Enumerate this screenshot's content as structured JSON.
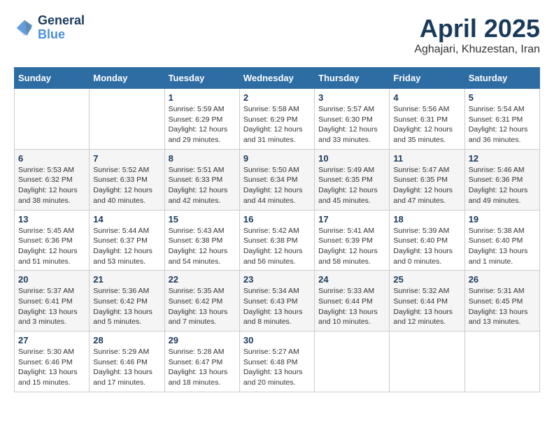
{
  "header": {
    "logo_general": "General",
    "logo_blue": "Blue",
    "month_title": "April 2025",
    "location": "Aghajari, Khuzestan, Iran"
  },
  "weekdays": [
    "Sunday",
    "Monday",
    "Tuesday",
    "Wednesday",
    "Thursday",
    "Friday",
    "Saturday"
  ],
  "weeks": [
    [
      {
        "day": "",
        "info": ""
      },
      {
        "day": "",
        "info": ""
      },
      {
        "day": "1",
        "info": "Sunrise: 5:59 AM\nSunset: 6:29 PM\nDaylight: 12 hours and 29 minutes."
      },
      {
        "day": "2",
        "info": "Sunrise: 5:58 AM\nSunset: 6:29 PM\nDaylight: 12 hours and 31 minutes."
      },
      {
        "day": "3",
        "info": "Sunrise: 5:57 AM\nSunset: 6:30 PM\nDaylight: 12 hours and 33 minutes."
      },
      {
        "day": "4",
        "info": "Sunrise: 5:56 AM\nSunset: 6:31 PM\nDaylight: 12 hours and 35 minutes."
      },
      {
        "day": "5",
        "info": "Sunrise: 5:54 AM\nSunset: 6:31 PM\nDaylight: 12 hours and 36 minutes."
      }
    ],
    [
      {
        "day": "6",
        "info": "Sunrise: 5:53 AM\nSunset: 6:32 PM\nDaylight: 12 hours and 38 minutes."
      },
      {
        "day": "7",
        "info": "Sunrise: 5:52 AM\nSunset: 6:33 PM\nDaylight: 12 hours and 40 minutes."
      },
      {
        "day": "8",
        "info": "Sunrise: 5:51 AM\nSunset: 6:33 PM\nDaylight: 12 hours and 42 minutes."
      },
      {
        "day": "9",
        "info": "Sunrise: 5:50 AM\nSunset: 6:34 PM\nDaylight: 12 hours and 44 minutes."
      },
      {
        "day": "10",
        "info": "Sunrise: 5:49 AM\nSunset: 6:35 PM\nDaylight: 12 hours and 45 minutes."
      },
      {
        "day": "11",
        "info": "Sunrise: 5:47 AM\nSunset: 6:35 PM\nDaylight: 12 hours and 47 minutes."
      },
      {
        "day": "12",
        "info": "Sunrise: 5:46 AM\nSunset: 6:36 PM\nDaylight: 12 hours and 49 minutes."
      }
    ],
    [
      {
        "day": "13",
        "info": "Sunrise: 5:45 AM\nSunset: 6:36 PM\nDaylight: 12 hours and 51 minutes."
      },
      {
        "day": "14",
        "info": "Sunrise: 5:44 AM\nSunset: 6:37 PM\nDaylight: 12 hours and 53 minutes."
      },
      {
        "day": "15",
        "info": "Sunrise: 5:43 AM\nSunset: 6:38 PM\nDaylight: 12 hours and 54 minutes."
      },
      {
        "day": "16",
        "info": "Sunrise: 5:42 AM\nSunset: 6:38 PM\nDaylight: 12 hours and 56 minutes."
      },
      {
        "day": "17",
        "info": "Sunrise: 5:41 AM\nSunset: 6:39 PM\nDaylight: 12 hours and 58 minutes."
      },
      {
        "day": "18",
        "info": "Sunrise: 5:39 AM\nSunset: 6:40 PM\nDaylight: 13 hours and 0 minutes."
      },
      {
        "day": "19",
        "info": "Sunrise: 5:38 AM\nSunset: 6:40 PM\nDaylight: 13 hours and 1 minute."
      }
    ],
    [
      {
        "day": "20",
        "info": "Sunrise: 5:37 AM\nSunset: 6:41 PM\nDaylight: 13 hours and 3 minutes."
      },
      {
        "day": "21",
        "info": "Sunrise: 5:36 AM\nSunset: 6:42 PM\nDaylight: 13 hours and 5 minutes."
      },
      {
        "day": "22",
        "info": "Sunrise: 5:35 AM\nSunset: 6:42 PM\nDaylight: 13 hours and 7 minutes."
      },
      {
        "day": "23",
        "info": "Sunrise: 5:34 AM\nSunset: 6:43 PM\nDaylight: 13 hours and 8 minutes."
      },
      {
        "day": "24",
        "info": "Sunrise: 5:33 AM\nSunset: 6:44 PM\nDaylight: 13 hours and 10 minutes."
      },
      {
        "day": "25",
        "info": "Sunrise: 5:32 AM\nSunset: 6:44 PM\nDaylight: 13 hours and 12 minutes."
      },
      {
        "day": "26",
        "info": "Sunrise: 5:31 AM\nSunset: 6:45 PM\nDaylight: 13 hours and 13 minutes."
      }
    ],
    [
      {
        "day": "27",
        "info": "Sunrise: 5:30 AM\nSunset: 6:46 PM\nDaylight: 13 hours and 15 minutes."
      },
      {
        "day": "28",
        "info": "Sunrise: 5:29 AM\nSunset: 6:46 PM\nDaylight: 13 hours and 17 minutes."
      },
      {
        "day": "29",
        "info": "Sunrise: 5:28 AM\nSunset: 6:47 PM\nDaylight: 13 hours and 18 minutes."
      },
      {
        "day": "30",
        "info": "Sunrise: 5:27 AM\nSunset: 6:48 PM\nDaylight: 13 hours and 20 minutes."
      },
      {
        "day": "",
        "info": ""
      },
      {
        "day": "",
        "info": ""
      },
      {
        "day": "",
        "info": ""
      }
    ]
  ]
}
